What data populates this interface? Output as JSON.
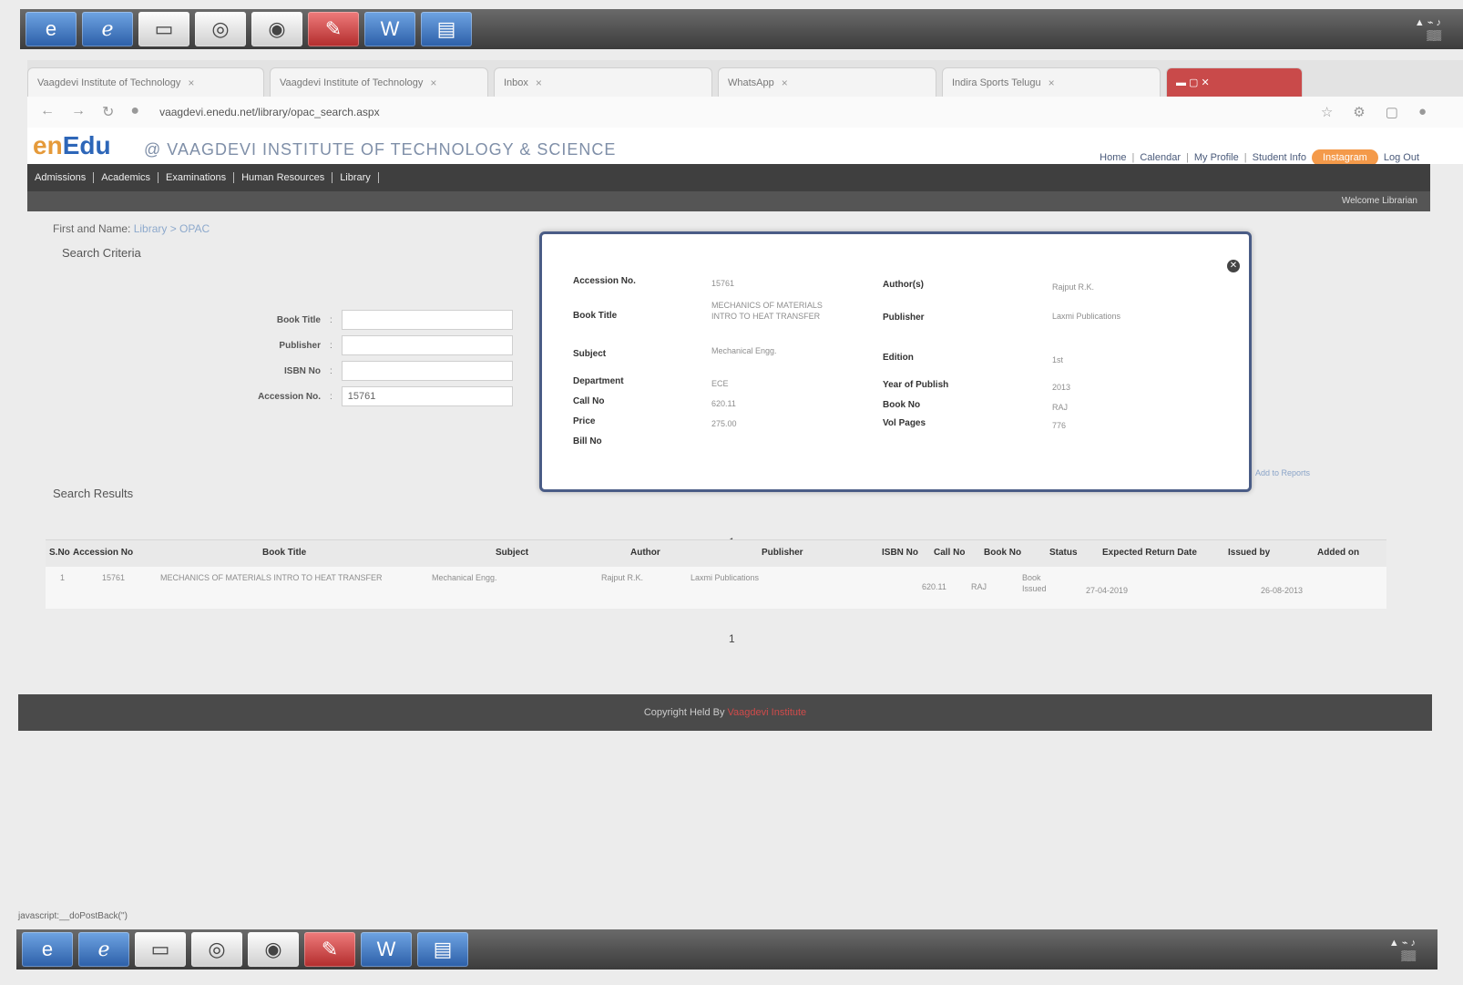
{
  "taskbar": {
    "top_apps": [
      "ie-icon",
      "edge-icon",
      "folder-icon",
      "media-icon",
      "chrome-icon",
      "acrobat-icon",
      "word-icon",
      "scanner-icon"
    ],
    "bottom_apps": [
      "ie-icon",
      "edge-icon",
      "folder-icon",
      "media-icon",
      "chrome-icon",
      "acrobat-icon",
      "word-icon",
      "scanner-icon"
    ]
  },
  "browser": {
    "tabs": [
      {
        "label": "Vaagdevi Institute of Technology"
      },
      {
        "label": "Vaagdevi Institute of Technology"
      },
      {
        "label": "Inbox"
      },
      {
        "label": "WhatsApp"
      },
      {
        "label": "Indira Sports Telugu"
      }
    ]
  },
  "header": {
    "logo_prefix": "en",
    "logo_main": "Edu",
    "institute": "@ VAAGDEVI INSTITUTE OF TECHNOLOGY & SCIENCE",
    "links": [
      "Home",
      "Calendar",
      "My Profile",
      "Student Info"
    ],
    "pill": "Instagram",
    "logout": "Log Out"
  },
  "menu": {
    "items": [
      "Admissions",
      "Academics",
      "Examinations",
      "Human Resources",
      "Library"
    ],
    "subbar": "Welcome Librarian"
  },
  "crumb": {
    "label": "First and Name:",
    "value": "Library > OPAC"
  },
  "search": {
    "title": "Search Criteria",
    "fields": [
      {
        "label": "Book Title",
        "value": ""
      },
      {
        "label": "Publisher",
        "value": ""
      },
      {
        "label": "ISBN No",
        "value": ""
      },
      {
        "label": "Accession No.",
        "value": "15761"
      }
    ]
  },
  "results": {
    "title": "Search Results",
    "page": "1",
    "columns": [
      "S.No",
      "Accession No",
      "Book Title",
      "Subject",
      "Author",
      "Publisher",
      "ISBN No",
      "Call No",
      "Book No",
      "Status",
      "Expected Return Date",
      "Issued by",
      "Added on"
    ],
    "rows": [
      {
        "sno": "1",
        "acc": "15761",
        "title": "MECHANICS OF MATERIALS INTRO TO HEAT TRANSFER",
        "subject": "Mechanical Engg.",
        "author": "Rajput R.K.",
        "publisher": "Laxmi Publications",
        "isbn": "",
        "call": "620.11",
        "bookno": "RAJ",
        "status": "Book Issued",
        "expected": "27-04-2019",
        "issued": "",
        "added": "26-08-2013"
      }
    ]
  },
  "modal": {
    "left": [
      {
        "label": "Accession No.",
        "value": "15761"
      },
      {
        "label": "Book Title",
        "value": "MECHANICS OF MATERIALS INTRO TO HEAT TRANSFER"
      },
      {
        "label": "Subject",
        "value": "Mechanical Engg."
      },
      {
        "label": "Department",
        "value": "ECE"
      },
      {
        "label": "Call No",
        "value": "620.11"
      },
      {
        "label": "Price",
        "value": "275.00"
      },
      {
        "label": "Bill No",
        "value": ""
      }
    ],
    "right": [
      {
        "label": "Author(s)",
        "value": "Rajput R.K."
      },
      {
        "label": "Publisher",
        "value": "Laxmi Publications"
      },
      {
        "label": "Edition",
        "value": "1st"
      },
      {
        "label": "Year of Publish",
        "value": "2013"
      },
      {
        "label": "Book No",
        "value": "RAJ"
      },
      {
        "label": "Vol Pages",
        "value": "776"
      }
    ],
    "extra_link": "Add to Reports"
  },
  "footer": {
    "text": "Copyright Held By ",
    "link": "Vaagdevi Institute"
  },
  "statusbar": "javascript:__doPostBack('')"
}
